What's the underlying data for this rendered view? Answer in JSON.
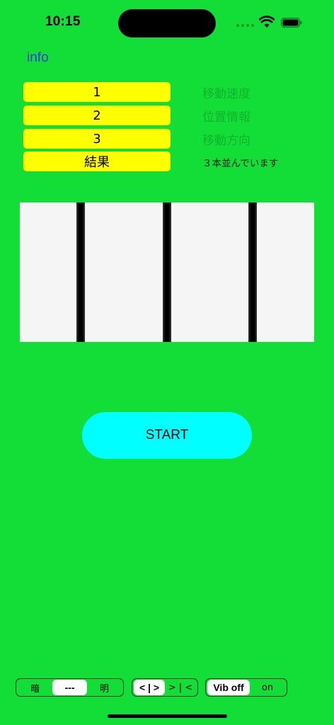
{
  "status_bar": {
    "time": "10:15"
  },
  "header": {
    "info_link": "info"
  },
  "buttons": [
    {
      "label": "1",
      "info": "移動速度"
    },
    {
      "label": "2",
      "info": "位置情報"
    },
    {
      "label": "3",
      "info": "移動方向"
    },
    {
      "label": "結果",
      "info": "３本並んでいます"
    }
  ],
  "main": {
    "start_label": "START"
  },
  "controls": {
    "brightness": {
      "options": [
        "暗",
        "---",
        "明"
      ],
      "selected": 1
    },
    "direction": {
      "options": [
        "< | >",
        "> | <"
      ],
      "selected": 0
    },
    "vibration": {
      "options": [
        "Vib off",
        "on"
      ],
      "selected": 0
    }
  },
  "colors": {
    "background": "#13DD37",
    "button_yellow": "#FFFF00",
    "start_cyan": "#00FFFF",
    "link_blue": "#1D3FD6",
    "panel": "#F5F5F5"
  }
}
